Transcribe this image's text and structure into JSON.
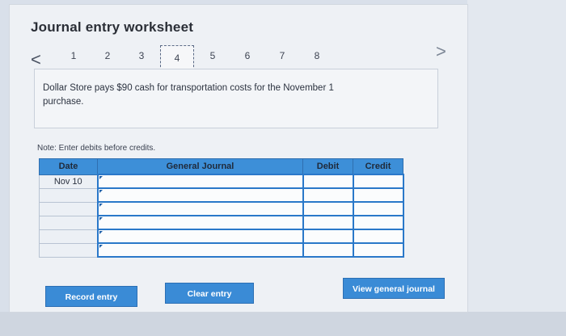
{
  "worksheet": {
    "title": "Journal entry worksheet",
    "pages": [
      "1",
      "2",
      "3",
      "4",
      "5",
      "6",
      "7",
      "8"
    ],
    "active_page": "4",
    "prev_icon": "<",
    "next_icon": ">",
    "problem_text": "Dollar Store pays $90 cash for transportation costs for the November 1 purchase.",
    "note": "Note: Enter debits before credits."
  },
  "journal": {
    "headers": {
      "date": "Date",
      "account": "General Journal",
      "debit": "Debit",
      "credit": "Credit"
    },
    "rows": [
      {
        "date": "Nov 10",
        "account": "",
        "debit": "",
        "credit": ""
      },
      {
        "date": "",
        "account": "",
        "debit": "",
        "credit": ""
      },
      {
        "date": "",
        "account": "",
        "debit": "",
        "credit": ""
      },
      {
        "date": "",
        "account": "",
        "debit": "",
        "credit": ""
      },
      {
        "date": "",
        "account": "",
        "debit": "",
        "credit": ""
      },
      {
        "date": "",
        "account": "",
        "debit": "",
        "credit": ""
      }
    ]
  },
  "buttons": {
    "record": "Record entry",
    "clear": "Clear entry",
    "view": "View general journal"
  },
  "colors": {
    "header_blue": "#3d8fd8",
    "button_blue": "#3a8bd6",
    "input_border": "#2a78c9"
  }
}
